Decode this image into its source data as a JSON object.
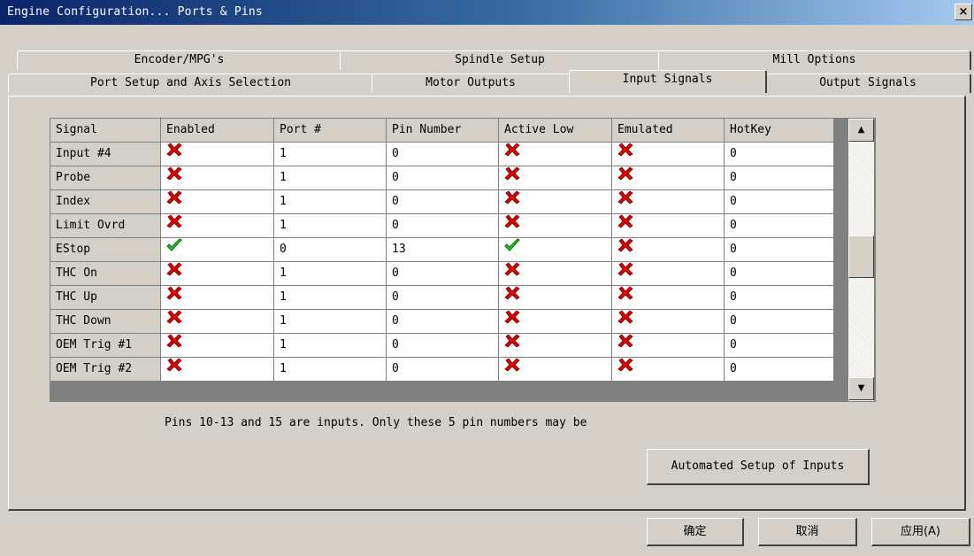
{
  "window": {
    "title": "Engine Configuration... Ports & Pins",
    "close_label": "×"
  },
  "tabs_back": [
    "Encoder/MPG's",
    "Spindle Setup",
    "Mill Options"
  ],
  "tabs_front": [
    "Port Setup and Axis Selection",
    "Motor Outputs",
    "Input Signals",
    "Output Signals"
  ],
  "active_tab": "Input Signals",
  "grid": {
    "columns": [
      "Signal",
      "Enabled",
      "Port #",
      "Pin Number",
      "Active Low",
      "Emulated",
      "HotKey"
    ],
    "rows": [
      {
        "signal": "Input #4",
        "enabled": false,
        "port": "1",
        "pin": "0",
        "active_low": false,
        "emulated": false,
        "hotkey": "0"
      },
      {
        "signal": "Probe",
        "enabled": false,
        "port": "1",
        "pin": "0",
        "active_low": false,
        "emulated": false,
        "hotkey": "0"
      },
      {
        "signal": "Index",
        "enabled": false,
        "port": "1",
        "pin": "0",
        "active_low": false,
        "emulated": false,
        "hotkey": "0"
      },
      {
        "signal": "Limit Ovrd",
        "enabled": false,
        "port": "1",
        "pin": "0",
        "active_low": false,
        "emulated": false,
        "hotkey": "0"
      },
      {
        "signal": "EStop",
        "enabled": true,
        "port": "0",
        "pin": "13",
        "active_low": true,
        "emulated": false,
        "hotkey": "0"
      },
      {
        "signal": "THC On",
        "enabled": false,
        "port": "1",
        "pin": "0",
        "active_low": false,
        "emulated": false,
        "hotkey": "0"
      },
      {
        "signal": "THC Up",
        "enabled": false,
        "port": "1",
        "pin": "0",
        "active_low": false,
        "emulated": false,
        "hotkey": "0"
      },
      {
        "signal": "THC Down",
        "enabled": false,
        "port": "1",
        "pin": "0",
        "active_low": false,
        "emulated": false,
        "hotkey": "0"
      },
      {
        "signal": "OEM Trig #1",
        "enabled": false,
        "port": "1",
        "pin": "0",
        "active_low": false,
        "emulated": false,
        "hotkey": "0"
      },
      {
        "signal": "OEM Trig #2",
        "enabled": false,
        "port": "1",
        "pin": "0",
        "active_low": false,
        "emulated": false,
        "hotkey": "0"
      }
    ]
  },
  "scrollbar": {
    "up_icon": "▲",
    "down_icon": "▼"
  },
  "info_text": "Pins 10-13 and 15 are inputs. Only these 5 pin numbers may be",
  "automated_setup_label": "Automated Setup of Inputs",
  "buttons": {
    "ok": "确定",
    "cancel": "取消",
    "apply": "应用(A)"
  },
  "icons": {
    "enabled": "green-check-icon",
    "disabled": "red-x-icon"
  },
  "colors": {
    "check": "#22cc22",
    "cross": "#dd0000",
    "title_start": "#0a246a",
    "title_end": "#a6caf0"
  }
}
